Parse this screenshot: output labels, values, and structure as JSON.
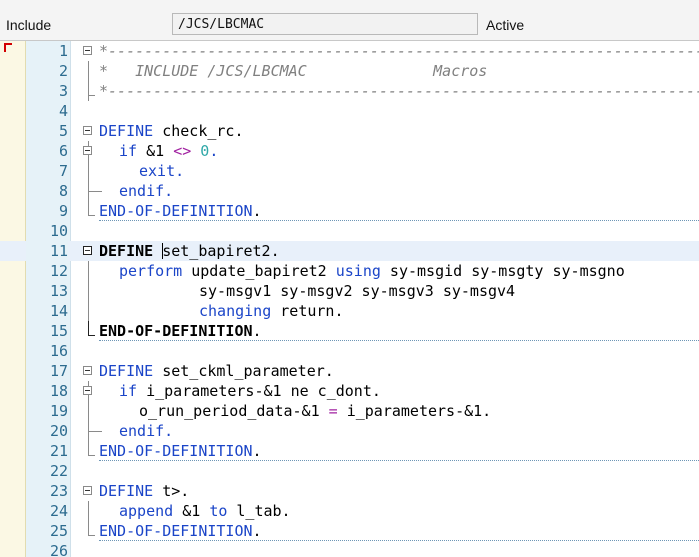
{
  "header": {
    "label": "Include",
    "program_name": "/JCS/LBCMAC",
    "status": "Active"
  },
  "editor": {
    "line_numbers": [
      "1",
      "2",
      "3",
      "4",
      "5",
      "6",
      "7",
      "8",
      "9",
      "10",
      "11",
      "12",
      "13",
      "14",
      "15",
      "16",
      "17",
      "18",
      "19",
      "20",
      "21",
      "22",
      "23",
      "24",
      "25",
      "26"
    ],
    "line1": "*-------------------------------------------------------------------",
    "line2": "*   INCLUDE /JCS/LBCMAC              Macros",
    "line3": "*-------------------------------------------------------------------",
    "line5": {
      "kw": "DEFINE",
      "text": " check_rc."
    },
    "line6": {
      "kw": "if",
      "a": " &1 ",
      "op": "<>",
      "sp": " ",
      "num": "0",
      "end": "."
    },
    "line7": {
      "kw": "exit",
      "end": "."
    },
    "line8": {
      "kw": "endif",
      "end": "."
    },
    "line9": {
      "kw": "END-OF-DEFINITION",
      "end": "."
    },
    "line11": {
      "kw": "DEFINE",
      "sp": " ",
      "text": "set_bapiret2."
    },
    "line12": {
      "kw1": "perform",
      "t1": " update_bapiret2 ",
      "kw2": "using",
      "t2": " sy-msgid sy-msgty sy-msgno"
    },
    "line13": {
      "text": "sy-msgv1 sy-msgv2 sy-msgv3 sy-msgv4"
    },
    "line14": {
      "kw": "changing",
      "text": " return."
    },
    "line15": {
      "kw": "END-OF-DEFINITION",
      "end": "."
    },
    "line17": {
      "kw": "DEFINE",
      "text": " set_ckml_parameter."
    },
    "line18": {
      "kw": "if",
      "text": " i_parameters-&1 ne c_dont."
    },
    "line19": {
      "a": "o_run_period_data-&1 ",
      "op": "=",
      "b": " i_parameters-&1."
    },
    "line20": {
      "kw": "endif",
      "end": "."
    },
    "line21": {
      "kw": "END-OF-DEFINITION",
      "end": "."
    },
    "line23": {
      "kw": "DEFINE",
      "text": " t>."
    },
    "line24": {
      "kw1": "append",
      "t1": " &1 ",
      "kw2": "to",
      "t2": " l_tab."
    },
    "line25": {
      "kw": "END-OF-DEFINITION",
      "end": "."
    }
  },
  "colors": {
    "keyword": "#1b45c8",
    "comment": "#808080",
    "number": "#2fa8a8",
    "operator": "#a020a0",
    "line_number": "#2c6b8f"
  }
}
